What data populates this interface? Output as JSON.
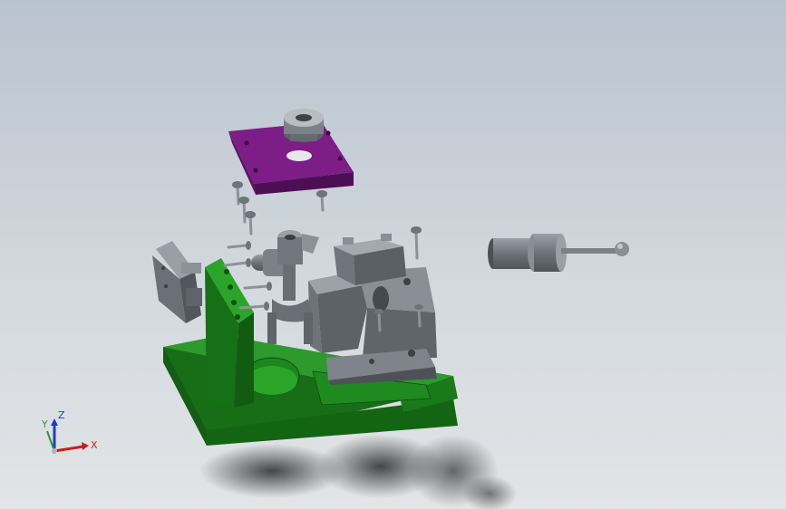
{
  "viewport": {
    "background_top": "#b9c3cf",
    "background_bottom": "#e2e4e6"
  },
  "colors": {
    "base_plate": "#1a7a1a",
    "top_plate": "#7a1a82",
    "steel": "#7c8088"
  },
  "triad": {
    "x_label": "X",
    "y_label": "Y",
    "z_label": "Z",
    "x_color": "#c81e1e",
    "y_color": "#2a9a2a",
    "z_color": "#1e3cc8"
  },
  "parts": [
    {
      "name": "base-plate",
      "color": "#1a7a1a"
    },
    {
      "name": "vertical-support",
      "color": "#1a7a1a"
    },
    {
      "name": "top-clamp-plate",
      "color": "#7a1a82"
    },
    {
      "name": "bushing"
    },
    {
      "name": "fork-workpiece"
    },
    {
      "name": "v-block"
    },
    {
      "name": "slider-block"
    },
    {
      "name": "side-block"
    },
    {
      "name": "handle"
    },
    {
      "name": "bolts"
    }
  ]
}
